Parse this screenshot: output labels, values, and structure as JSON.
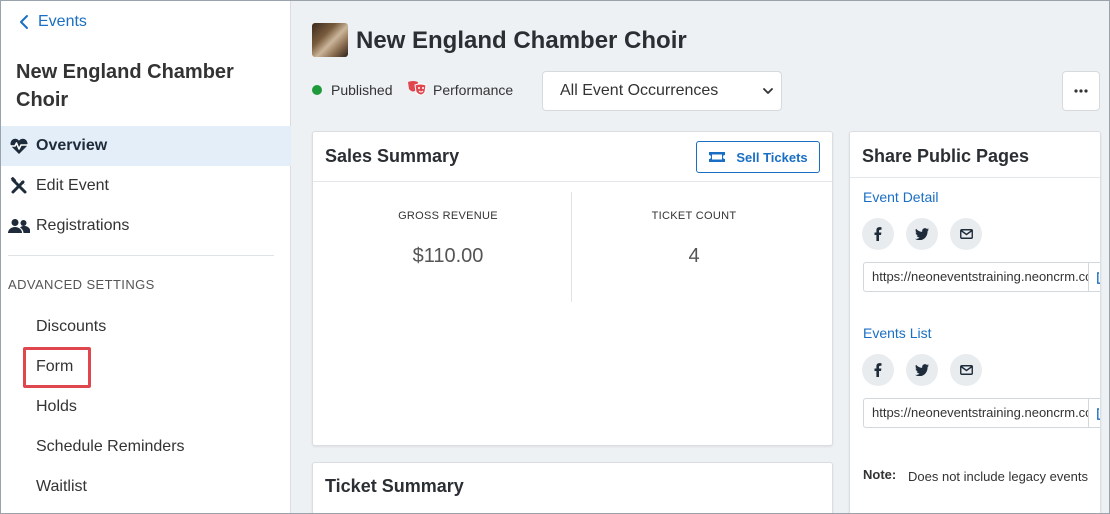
{
  "sidebar": {
    "back_label": "Events",
    "event_title": "New England Chamber Choir",
    "nav": [
      {
        "label": "Overview",
        "icon": "heartbeat-icon",
        "active": true
      },
      {
        "label": "Edit Event",
        "icon": "tools-icon"
      },
      {
        "label": "Registrations",
        "icon": "users-icon"
      }
    ],
    "advanced_heading": "ADVANCED SETTINGS",
    "advanced_items": [
      "Discounts",
      "Form",
      "Holds",
      "Schedule Reminders",
      "Waitlist"
    ]
  },
  "header": {
    "title": "New England Chamber Choir",
    "status": "Published",
    "status_color": "#1f9a3a",
    "category": "Performance",
    "occurrence_select": "All Event Occurrences"
  },
  "sales_summary": {
    "title": "Sales Summary",
    "sell_button": "Sell Tickets",
    "gross_revenue_label": "GROSS REVENUE",
    "gross_revenue_value": "$110.00",
    "ticket_count_label": "TICKET COUNT",
    "ticket_count_value": "4"
  },
  "ticket_summary": {
    "title": "Ticket Summary"
  },
  "share": {
    "title": "Share Public Pages",
    "event_detail_label": "Event Detail",
    "event_detail_url": "https://neoneventstraining.neoncrm.com/np/clients/neoneventstraining/event.jsp",
    "events_list_label": "Events List",
    "events_list_url": "https://neoneventstraining.neoncrm.com/np/clients/neoneventstraining/eventList.jsp",
    "note_label": "Note:",
    "note_text": "Does not include legacy events"
  },
  "colors": {
    "accent": "#1a6fc4",
    "highlight": "#e0464e",
    "active_bg": "#e3eef9"
  }
}
